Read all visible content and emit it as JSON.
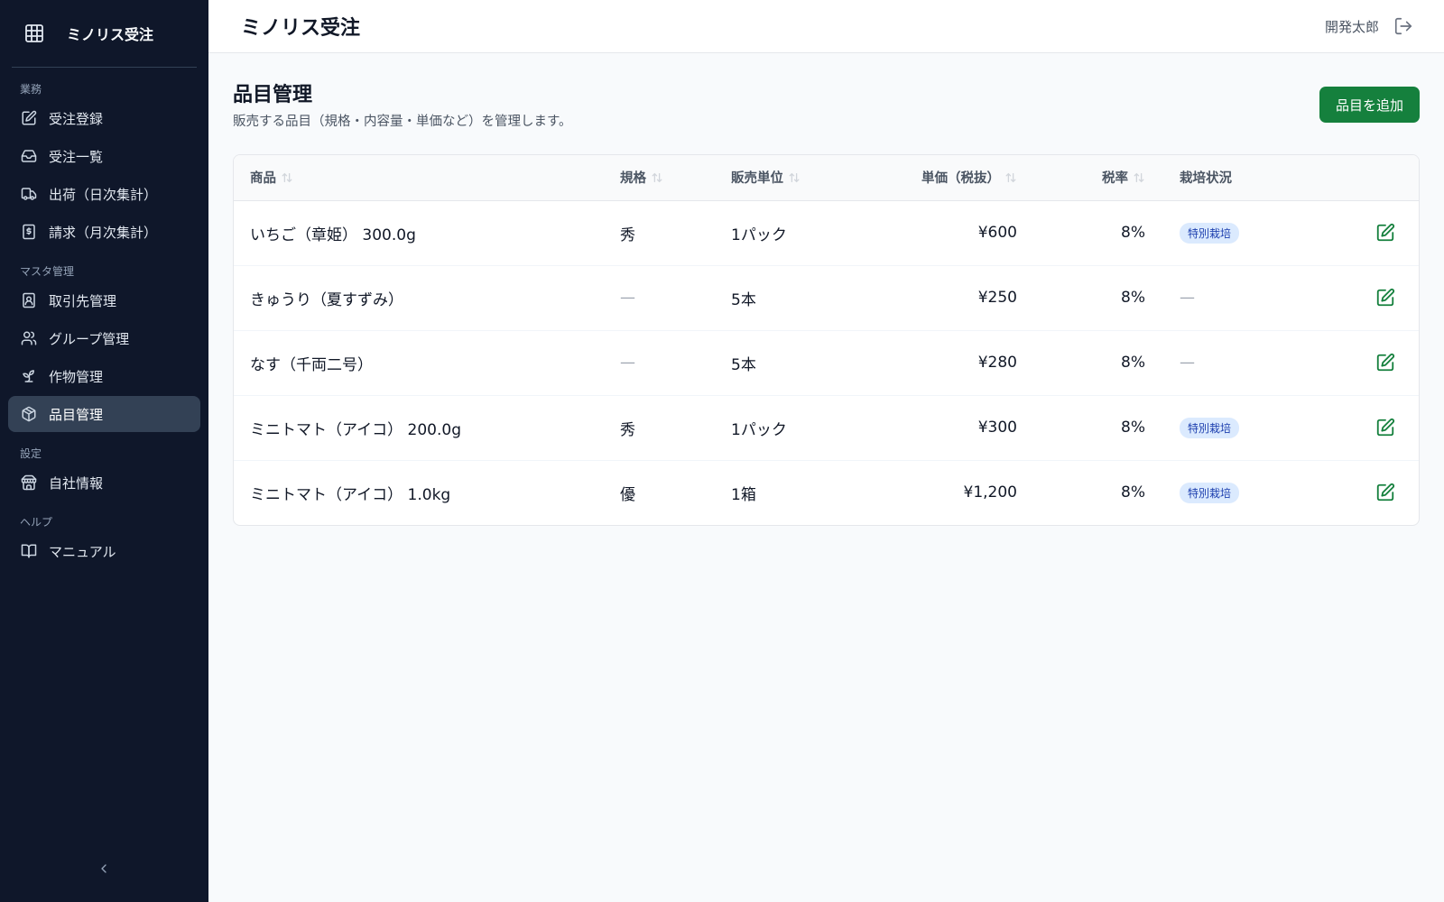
{
  "app": {
    "name": "ミノリス受注"
  },
  "header": {
    "title": "ミノリス受注",
    "user": "開発太郎"
  },
  "sidebar": {
    "sections": [
      {
        "label": "業務",
        "items": [
          {
            "label": "受注登録",
            "icon": "edit-square-icon"
          },
          {
            "label": "受注一覧",
            "icon": "inbox-icon"
          },
          {
            "label": "出荷（日次集計）",
            "icon": "truck-icon"
          },
          {
            "label": "請求（月次集計）",
            "icon": "receipt-icon"
          }
        ]
      },
      {
        "label": "マスタ管理",
        "items": [
          {
            "label": "取引先管理",
            "icon": "contact-card-icon"
          },
          {
            "label": "グループ管理",
            "icon": "users-icon"
          },
          {
            "label": "作物管理",
            "icon": "sprout-icon"
          },
          {
            "label": "品目管理",
            "icon": "package-icon",
            "active": true
          }
        ]
      },
      {
        "label": "設定",
        "items": [
          {
            "label": "自社情報",
            "icon": "store-icon"
          }
        ]
      },
      {
        "label": "ヘルプ",
        "items": [
          {
            "label": "マニュアル",
            "icon": "book-open-icon"
          }
        ]
      }
    ]
  },
  "page": {
    "title": "品目管理",
    "subtitle": "販売する品目（規格・内容量・単価など）を管理します。",
    "add_button": "品目を追加"
  },
  "table": {
    "columns": [
      "商品",
      "規格",
      "販売単位",
      "単価（税抜）",
      "税率",
      "栽培状況"
    ],
    "rows": [
      {
        "product": "いちご（章姫） 300.0g",
        "grade": "秀",
        "unit": "1パック",
        "price": "¥600",
        "tax": "8%",
        "cultivation": "特別栽培"
      },
      {
        "product": "きゅうり（夏すずみ）",
        "grade": "—",
        "unit": "5本",
        "price": "¥250",
        "tax": "8%",
        "cultivation": "—"
      },
      {
        "product": "なす（千両二号）",
        "grade": "—",
        "unit": "5本",
        "price": "¥280",
        "tax": "8%",
        "cultivation": "—"
      },
      {
        "product": "ミニトマト（アイコ） 200.0g",
        "grade": "秀",
        "unit": "1パック",
        "price": "¥300",
        "tax": "8%",
        "cultivation": "特別栽培"
      },
      {
        "product": "ミニトマト（アイコ） 1.0kg",
        "grade": "優",
        "unit": "1箱",
        "price": "¥1,200",
        "tax": "8%",
        "cultivation": "特別栽培"
      }
    ]
  },
  "colors": {
    "sidebar_bg": "#0f172a",
    "accent": "#15803d",
    "badge_bg": "#dbeafe",
    "badge_text": "#1e40af"
  }
}
